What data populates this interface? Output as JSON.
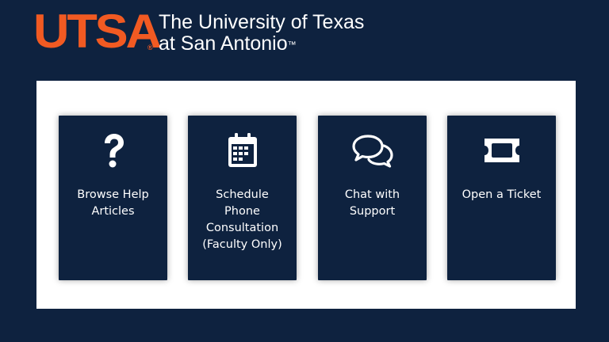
{
  "brand": {
    "logo_text": "UTSA",
    "registered_mark": "®",
    "university_line1": "The University of Texas",
    "university_line2": "at San Antonio",
    "trademark": "™",
    "colors": {
      "orange": "#f15a22",
      "navy": "#0e223f",
      "white": "#ffffff"
    }
  },
  "cards": [
    {
      "label": "Browse Help\nArticles",
      "icon": "question-mark-icon"
    },
    {
      "label": "Schedule\nPhone\nConsultation\n(Faculty Only)",
      "icon": "calendar-icon"
    },
    {
      "label": "Chat with\nSupport",
      "icon": "chat-bubbles-icon"
    },
    {
      "label": "Open a Ticket",
      "icon": "ticket-icon"
    }
  ]
}
